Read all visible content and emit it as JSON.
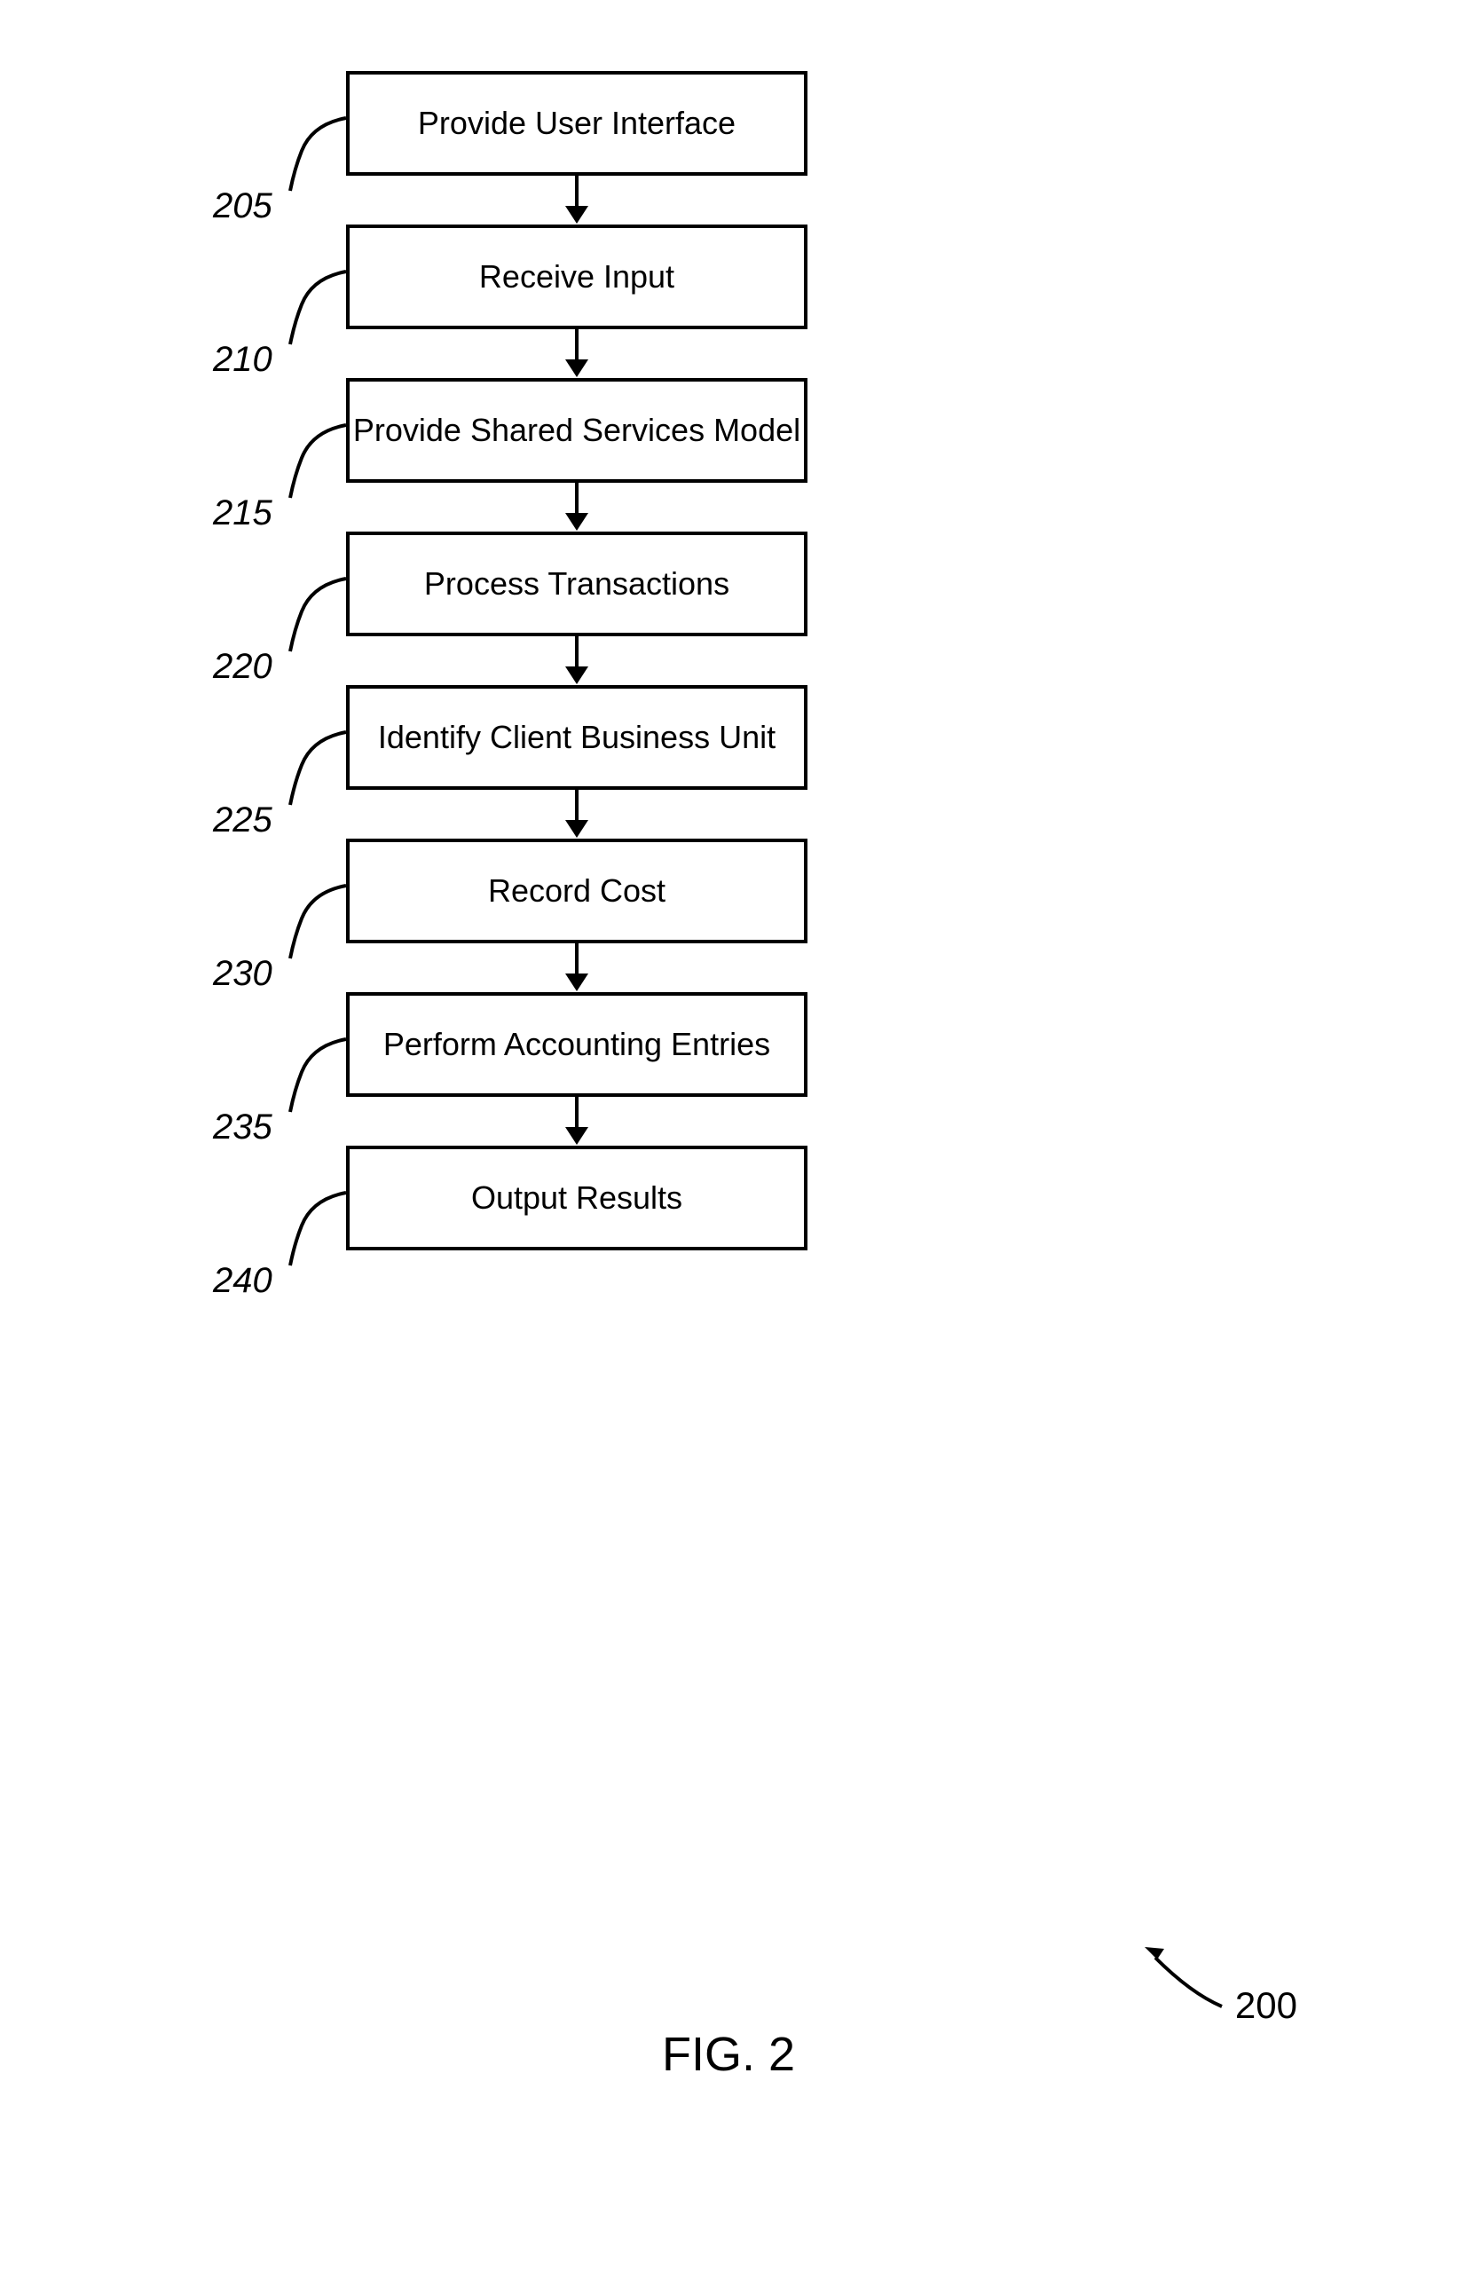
{
  "flowchart": {
    "steps": [
      {
        "ref": "205",
        "label": "Provide User Interface"
      },
      {
        "ref": "210",
        "label": "Receive Input"
      },
      {
        "ref": "215",
        "label": "Provide Shared Services Model"
      },
      {
        "ref": "220",
        "label": "Process Transactions"
      },
      {
        "ref": "225",
        "label": "Identify Client Business Unit"
      },
      {
        "ref": "230",
        "label": "Record Cost"
      },
      {
        "ref": "235",
        "label": "Perform Accounting Entries"
      },
      {
        "ref": "240",
        "label": "Output Results"
      }
    ]
  },
  "figure": {
    "label": "FIG. 2",
    "ref": "200"
  }
}
